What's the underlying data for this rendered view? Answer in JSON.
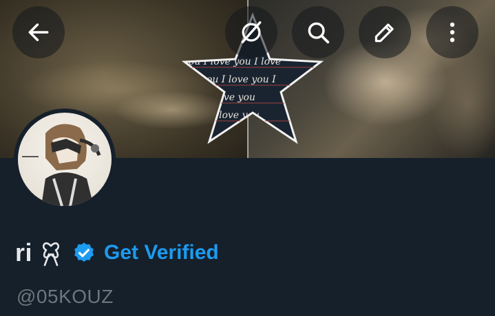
{
  "profile": {
    "display_name": "ri",
    "handle": "@05KOUZ",
    "get_verified_label": "Get Verified"
  },
  "banner": {
    "star_text_lines": [
      "you I love you I love",
      "you I love you I",
      "I love you",
      "I love you"
    ]
  },
  "header_buttons": {
    "back": "back-arrow-icon",
    "grok": "grok-icon",
    "search": "search-icon",
    "edit": "edit-icon",
    "more": "more-vertical-icon"
  },
  "colors": {
    "background": "#15202b",
    "accent": "#1d9bf0",
    "text_primary": "#e7e9ea",
    "text_secondary": "#6e767d"
  }
}
